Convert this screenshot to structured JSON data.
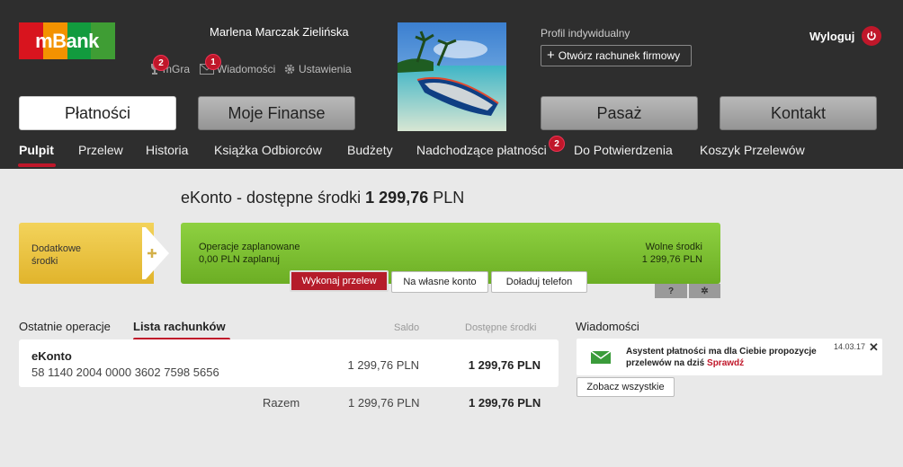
{
  "brand": {
    "logo_text": "mBank",
    "colors": [
      "#d8141e",
      "#f39200",
      "#129b3e",
      "#3f9d34"
    ],
    "accent": "#c0172a"
  },
  "header": {
    "user_name": "Marlena Marczak Zielińska",
    "utils": [
      {
        "label": "mGra",
        "icon": "trophy-icon",
        "badge": "2"
      },
      {
        "label": "Wiadomości",
        "icon": "envelope-icon",
        "badge": "1"
      },
      {
        "label": "Ustawienia",
        "icon": "gear-icon"
      }
    ],
    "profile_label": "Profil indywidualny",
    "open_business": "Otwórz rachunek firmowy",
    "logout": "Wyloguj"
  },
  "main_nav": [
    {
      "label": "Płatności",
      "active": true
    },
    {
      "label": "Moje Finanse",
      "active": false
    },
    {
      "label": "Pasaż",
      "active": false
    },
    {
      "label": "Kontakt",
      "active": false
    }
  ],
  "sub_nav": [
    {
      "label": "Pulpit"
    },
    {
      "label": "Przelew"
    },
    {
      "label": "Historia"
    },
    {
      "label": "Książka Odbiorców"
    },
    {
      "label": "Budżety"
    },
    {
      "label": "Nadchodzące płatności",
      "badge": "2"
    },
    {
      "label": "Do Potwierdzenia"
    },
    {
      "label": "Koszyk Przelewów"
    }
  ],
  "ekonto": {
    "title_prefix": "eKonto - dostępne środki",
    "amount": "1 299,76",
    "currency": "PLN",
    "additional_funds": [
      "Dodatkowe",
      "środki"
    ],
    "planned_label": "Operacje zaplanowane",
    "planned_value": "0,00 PLN zaplanuj",
    "free_label": "Wolne środki",
    "free_value": "1 299,76 PLN",
    "actions": [
      "Wykonaj przelew",
      "Na własne konto",
      "Doładuj telefon"
    ],
    "help_label": "?",
    "settings_label": "✲"
  },
  "accounts": {
    "tabs": [
      "Ostatnie operacje",
      "Lista rachunków"
    ],
    "col_saldo": "Saldo",
    "col_available": "Dostępne środki",
    "rows": [
      {
        "name": "eKonto",
        "number": "58 1140 2004 0000 3602 7598 5656",
        "saldo": "1 299,76 PLN",
        "available": "1 299,76 PLN"
      }
    ],
    "total_label": "Razem",
    "total_saldo": "1 299,76 PLN",
    "total_available": "1 299,76 PLN"
  },
  "messages": {
    "title": "Wiadomości",
    "items": [
      {
        "text": "Asystent płatności ma dla Ciebie propozycje przelewów na dziś",
        "link": "Sprawdź",
        "date": "14.03.17"
      }
    ],
    "close": "✕",
    "see_all": "Zobacz wszystkie"
  }
}
